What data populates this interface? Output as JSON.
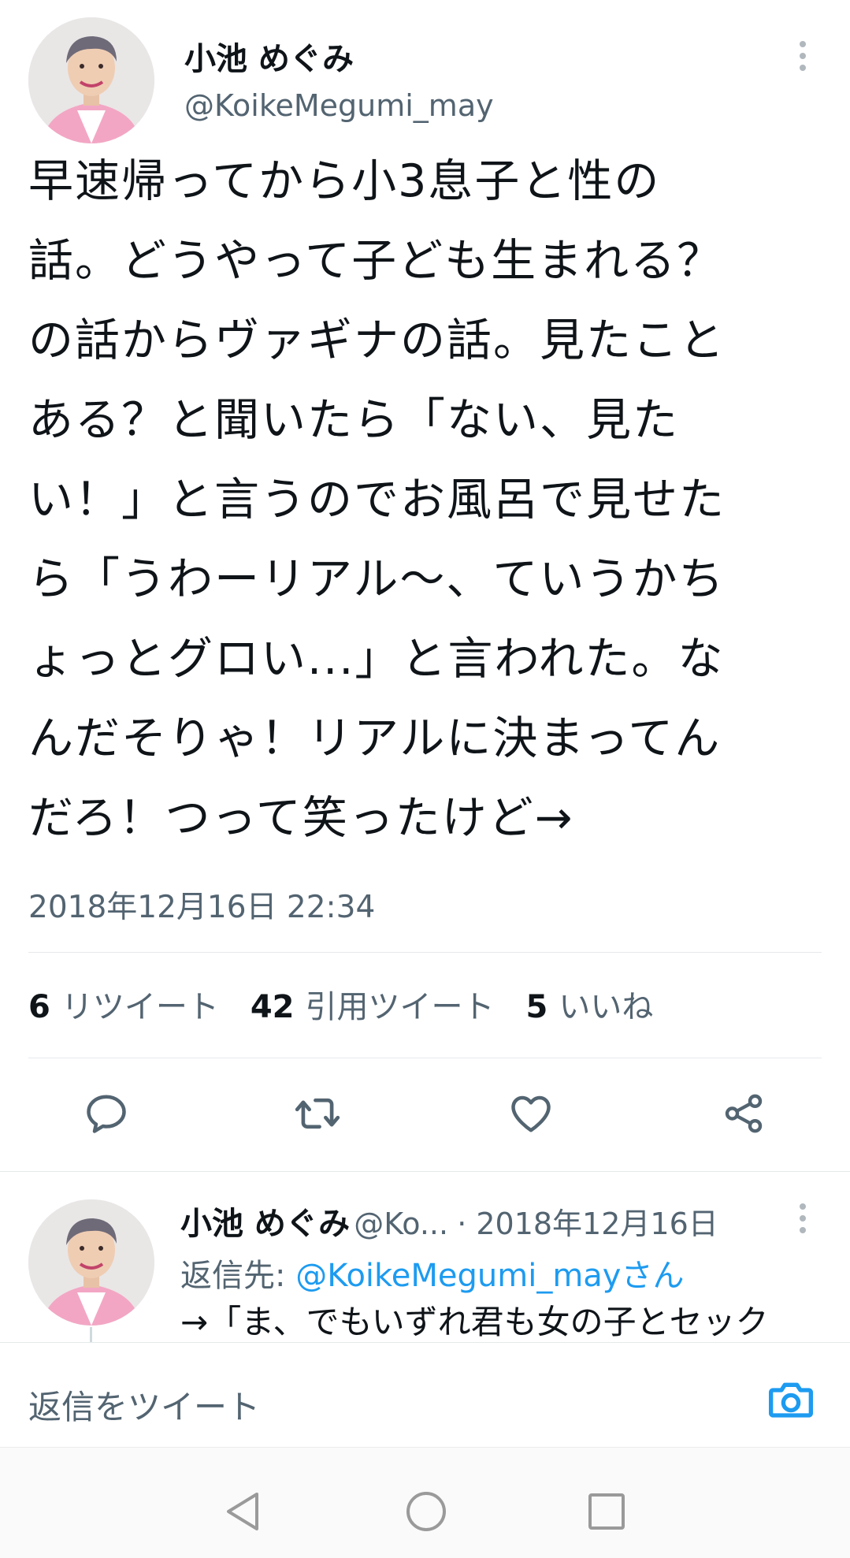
{
  "tweet": {
    "author_name": "小池 めぐみ",
    "author_handle": "@KoikeMegumi_may",
    "text": "早速帰ってから小3息子と性の\n話。どうやって子ども生まれる？\nの話からヴァギナの話。見たこと\nある？と聞いたら「ない、見た\nい！」と言うのでお風呂で見せた\nら「うわーリアル〜、ていうかち\nょっとグロい...」と言われた。な\nんだそりゃ！リアルに決まってん\nだろ！つって笑ったけど→",
    "timestamp": "2018年12月16日 22:34"
  },
  "stats": {
    "retweets_count": "6",
    "retweets_label": "リツイート",
    "quotes_count": "42",
    "quotes_label": "引用ツイート",
    "likes_count": "5",
    "likes_label": "いいね"
  },
  "actions": {
    "reply_icon": "reply-icon",
    "retweet_icon": "retweet-icon",
    "like_icon": "heart-icon",
    "share_icon": "share-icon"
  },
  "reply": {
    "author_name": "小池 めぐみ",
    "author_handle_truncated": "@Ko...",
    "separator_date": "· 2018年12月16日",
    "replying_to_prefix": "返信先: ",
    "replying_to_mention": "@KoikeMegumi_mayさん",
    "text_preview": "→「ま、でもいずれ君も女の子とセック"
  },
  "compose": {
    "placeholder": "返信をツイート",
    "camera_icon": "camera-icon"
  },
  "colors": {
    "accent": "#1d9bf0",
    "text_primary": "#0f1419",
    "text_secondary": "#536471",
    "avatar_jacket": "#f3a6c4"
  }
}
